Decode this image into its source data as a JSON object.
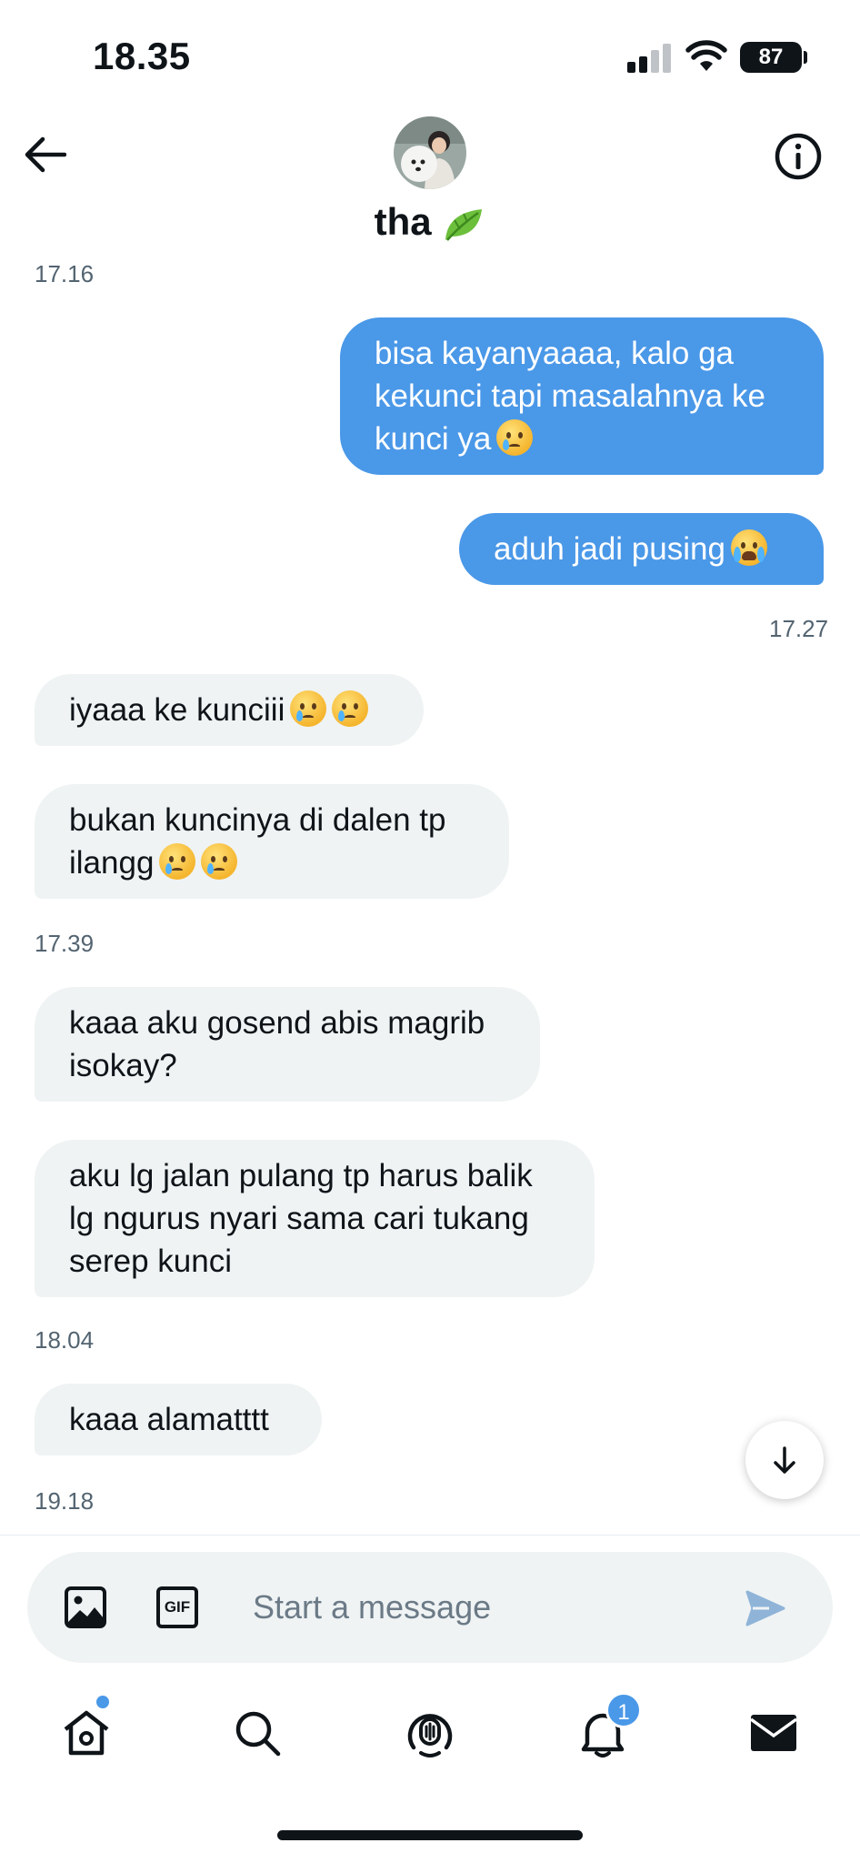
{
  "status_bar": {
    "time": "18.35",
    "battery": "87"
  },
  "header": {
    "contact_name": "tha",
    "leaf_emoji": "leaf-icon"
  },
  "messages": [
    {
      "type": "timestamp",
      "text": "17.16"
    },
    {
      "type": "sent",
      "text": "bisa kayanyaaaa, kalo ga kekunci tapi masalahnya ke kunci ya"
    },
    {
      "type": "sent",
      "text": "aduh jadi pusing"
    },
    {
      "type": "timestamp",
      "text": "17.27"
    },
    {
      "type": "received",
      "text": "iyaaa ke kunciii"
    },
    {
      "type": "received",
      "text_line1": "bukan kuncinya di dalen tp",
      "text_line2": "ilangg"
    },
    {
      "type": "timestamp",
      "text": "17.39"
    },
    {
      "type": "received",
      "text": "kaaa aku gosend abis magrib isokay?"
    },
    {
      "type": "received",
      "text": "aku lg jalan pulang tp harus balik lg ngurus nyari sama cari tukang serep kunci"
    },
    {
      "type": "timestamp",
      "text": "18.04"
    },
    {
      "type": "received",
      "text": "kaaa alamatttt"
    },
    {
      "type": "timestamp",
      "text": "19.18"
    }
  ],
  "composer": {
    "placeholder": "Start a message",
    "gif_label": "GIF"
  },
  "tabbar": {
    "notifications_count": "1"
  },
  "colors": {
    "accent": "#4a98e8",
    "received_bubble": "#eff3f4",
    "text": "#0f1419",
    "muted": "#536471"
  }
}
